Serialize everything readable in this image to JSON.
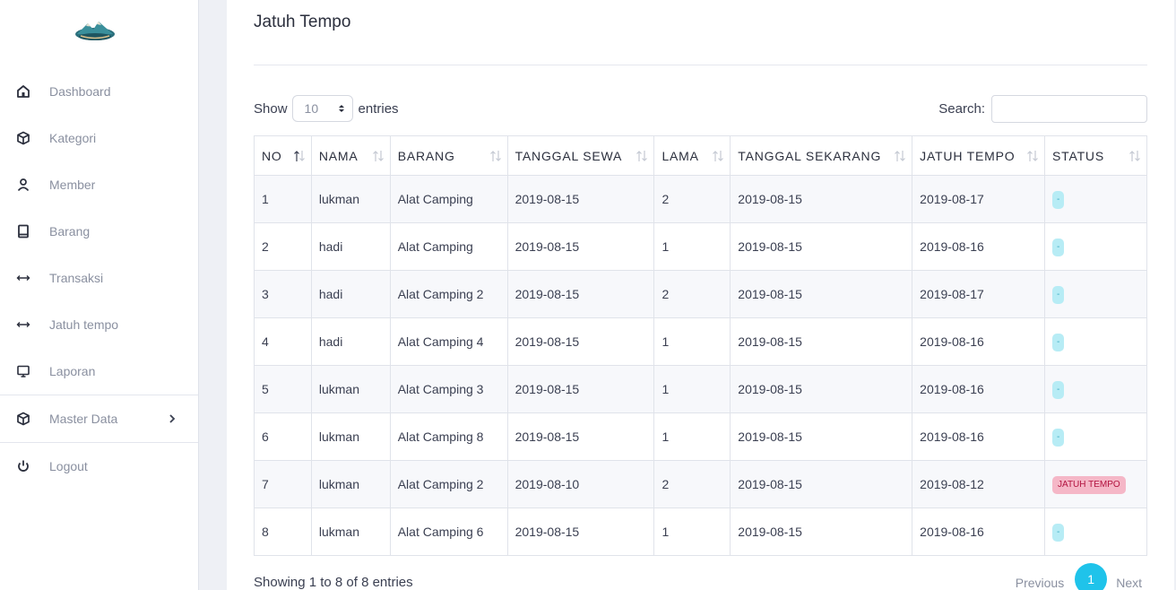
{
  "sidebar": {
    "items": [
      {
        "label": "Dashboard",
        "icon": "home-icon"
      },
      {
        "label": "Kategori",
        "icon": "package-icon"
      },
      {
        "label": "Member",
        "icon": "user-icon"
      },
      {
        "label": "Barang",
        "icon": "book-icon"
      },
      {
        "label": "Transaksi",
        "icon": "arrows-horizontal-icon"
      },
      {
        "label": "Jatuh tempo",
        "icon": "arrows-horizontal-icon"
      },
      {
        "label": "Laporan",
        "icon": "monitor-icon"
      },
      {
        "label": "Master Data",
        "icon": "package-icon"
      },
      {
        "label": "Logout",
        "icon": "power-icon"
      }
    ]
  },
  "main": {
    "title": "Jatuh Tempo",
    "show_label": "Show",
    "entries_label": "entries",
    "length_value": "10",
    "search_label": "Search:",
    "search_value": "",
    "columns": [
      "NO",
      "NAMA",
      "BARANG",
      "TANGGAL SEWA",
      "LAMA",
      "TANGGAL SEKARANG",
      "JATUH TEMPO",
      "STATUS"
    ],
    "rows": [
      {
        "no": "1",
        "nama": "lukman",
        "barang": "Alat Camping",
        "tanggal_sewa": "2019-08-15",
        "lama": "2",
        "tanggal_sekarang": "2019-08-15",
        "jatuh_tempo": "2019-08-17",
        "status": "-",
        "status_type": "info"
      },
      {
        "no": "2",
        "nama": "hadi",
        "barang": "Alat Camping",
        "tanggal_sewa": "2019-08-15",
        "lama": "1",
        "tanggal_sekarang": "2019-08-15",
        "jatuh_tempo": "2019-08-16",
        "status": "-",
        "status_type": "info"
      },
      {
        "no": "3",
        "nama": "hadi",
        "barang": "Alat Camping 2",
        "tanggal_sewa": "2019-08-15",
        "lama": "2",
        "tanggal_sekarang": "2019-08-15",
        "jatuh_tempo": "2019-08-17",
        "status": "-",
        "status_type": "info"
      },
      {
        "no": "4",
        "nama": "hadi",
        "barang": "Alat Camping 4",
        "tanggal_sewa": "2019-08-15",
        "lama": "1",
        "tanggal_sekarang": "2019-08-15",
        "jatuh_tempo": "2019-08-16",
        "status": "-",
        "status_type": "info"
      },
      {
        "no": "5",
        "nama": "lukman",
        "barang": "Alat Camping 3",
        "tanggal_sewa": "2019-08-15",
        "lama": "1",
        "tanggal_sekarang": "2019-08-15",
        "jatuh_tempo": "2019-08-16",
        "status": "-",
        "status_type": "info"
      },
      {
        "no": "6",
        "nama": "lukman",
        "barang": "Alat Camping 8",
        "tanggal_sewa": "2019-08-15",
        "lama": "1",
        "tanggal_sekarang": "2019-08-15",
        "jatuh_tempo": "2019-08-16",
        "status": "-",
        "status_type": "info"
      },
      {
        "no": "7",
        "nama": "lukman",
        "barang": "Alat Camping 2",
        "tanggal_sewa": "2019-08-10",
        "lama": "2",
        "tanggal_sekarang": "2019-08-15",
        "jatuh_tempo": "2019-08-12",
        "status": "JATUH TEMPO",
        "status_type": "danger"
      },
      {
        "no": "8",
        "nama": "lukman",
        "barang": "Alat Camping 6",
        "tanggal_sewa": "2019-08-15",
        "lama": "1",
        "tanggal_sekarang": "2019-08-15",
        "jatuh_tempo": "2019-08-16",
        "status": "-",
        "status_type": "info"
      }
    ],
    "info_text": "Showing 1 to 8 of 8 entries",
    "pagination": {
      "previous": "Previous",
      "current": "1",
      "next": "Next"
    }
  },
  "colors": {
    "accent": "#1fc3ea",
    "badge_info_bg": "#b7ecf5",
    "badge_danger_bg": "#f5b7c7"
  }
}
